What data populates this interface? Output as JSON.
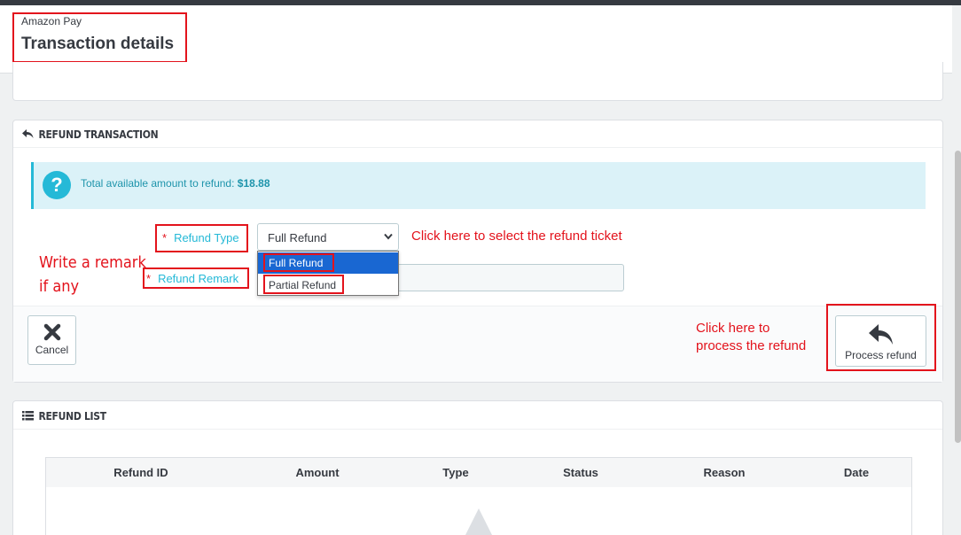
{
  "header": {
    "breadcrumb": "Amazon Pay",
    "title": "Transaction details"
  },
  "refund_panel": {
    "title": "REFUND TRANSACTION",
    "alert_prefix": "Total available amount to refund:",
    "alert_amount": "$18.88",
    "refund_type_label": "Refund Type",
    "refund_type_value": "Full Refund",
    "refund_type_options": [
      "Full Refund",
      "Partial Refund"
    ],
    "refund_remark_label": "Refund Remark",
    "required_mark": "*",
    "cancel_label": "Cancel",
    "process_label": "Process refund"
  },
  "refund_list": {
    "title": "REFUND LIST",
    "columns": [
      "Refund ID",
      "Amount",
      "Type",
      "Status",
      "Reason",
      "Date"
    ]
  },
  "annotations": {
    "select_hint": "Click here to select the refund ticket",
    "remark_hint_line1": "Write a remark",
    "remark_hint_line2": "if any",
    "process_hint_line1": "Click here to",
    "process_hint_line2": "process the refund"
  },
  "colors": {
    "accent": "#25b9d7",
    "annotation": "#e3131c",
    "selected_option": "#1967d2"
  }
}
